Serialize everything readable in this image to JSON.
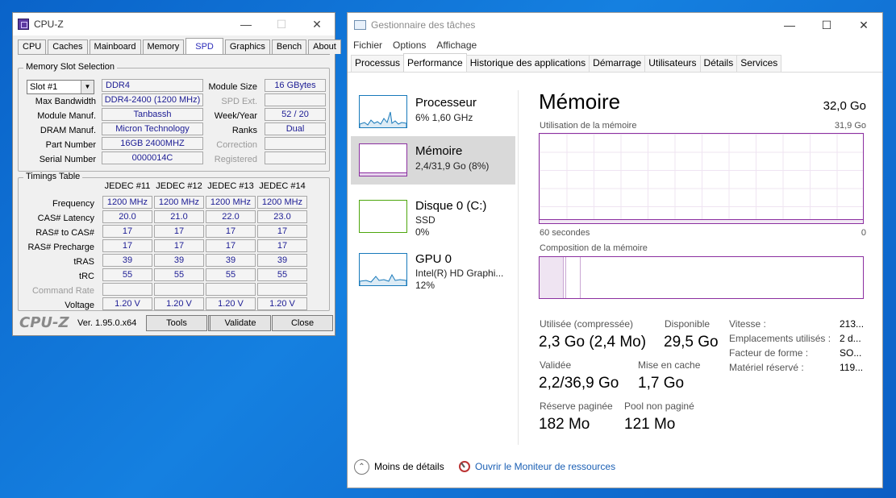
{
  "cpuz": {
    "title": "CPU-Z",
    "tabs": [
      "CPU",
      "Caches",
      "Mainboard",
      "Memory",
      "SPD",
      "Graphics",
      "Bench",
      "About"
    ],
    "active_tab": "SPD",
    "slot_group_title": "Memory Slot Selection",
    "slot_value": "Slot #1",
    "mem_type": "DDR4",
    "module_size_label": "Module Size",
    "module_size": "16 GBytes",
    "max_bw_label": "Max Bandwidth",
    "max_bw": "DDR4-2400 (1200 MHz)",
    "spd_ext_label": "SPD Ext.",
    "module_manuf_label": "Module Manuf.",
    "module_manuf": "Tanbassh",
    "weekyear_label": "Week/Year",
    "weekyear": "52 / 20",
    "dram_manuf_label": "DRAM Manuf.",
    "dram_manuf": "Micron Technology",
    "ranks_label": "Ranks",
    "ranks": "Dual",
    "part_label": "Part Number",
    "part": "16GB 2400MHZ",
    "correction_label": "Correction",
    "serial_label": "Serial Number",
    "serial": "0000014C",
    "registered_label": "Registered",
    "timings_title": "Timings Table",
    "timing_columns": [
      "JEDEC #11",
      "JEDEC #12",
      "JEDEC #13",
      "JEDEC #14"
    ],
    "timing_rows": [
      {
        "label": "Frequency",
        "values": [
          "1200 MHz",
          "1200 MHz",
          "1200 MHz",
          "1200 MHz"
        ]
      },
      {
        "label": "CAS# Latency",
        "values": [
          "20.0",
          "21.0",
          "22.0",
          "23.0"
        ]
      },
      {
        "label": "RAS# to CAS#",
        "values": [
          "17",
          "17",
          "17",
          "17"
        ]
      },
      {
        "label": "RAS# Precharge",
        "values": [
          "17",
          "17",
          "17",
          "17"
        ]
      },
      {
        "label": "tRAS",
        "values": [
          "39",
          "39",
          "39",
          "39"
        ]
      },
      {
        "label": "tRC",
        "values": [
          "55",
          "55",
          "55",
          "55"
        ]
      },
      {
        "label": "Command Rate",
        "values": [
          "",
          "",
          "",
          ""
        ]
      },
      {
        "label": "Voltage",
        "values": [
          "1.20 V",
          "1.20 V",
          "1.20 V",
          "1.20 V"
        ]
      }
    ],
    "brand": "CPU-Z",
    "version": "Ver. 1.95.0.x64",
    "tools": "Tools",
    "validate": "Validate",
    "close": "Close"
  },
  "tm": {
    "title": "Gestionnaire des tâches",
    "menu": [
      "Fichier",
      "Options",
      "Affichage"
    ],
    "tabs": [
      "Processus",
      "Performance",
      "Historique des applications",
      "Démarrage",
      "Utilisateurs",
      "Détails",
      "Services"
    ],
    "active_tab": "Performance",
    "items": [
      {
        "name": "Processeur",
        "line1": "6%  1,60 GHz",
        "line2": "",
        "color": "#1779ba"
      },
      {
        "name": "Mémoire",
        "line1": "2,4/31,9 Go (8%)",
        "line2": "",
        "color": "#8b2fa0"
      },
      {
        "name": "Disque 0 (C:)",
        "line1": "SSD",
        "line2": "0%",
        "color": "#4da60c"
      },
      {
        "name": "GPU 0",
        "line1": "Intel(R) HD Graphi...",
        "line2": "12%",
        "color": "#1779ba"
      }
    ],
    "heading": "Mémoire",
    "total": "32,0 Go",
    "usage_label": "Utilisation de la mémoire",
    "usage_max": "31,9 Go",
    "axis_left": "60 secondes",
    "axis_right": "0",
    "usage_level": 0.08,
    "composition_label": "Composition de la mémoire",
    "stats": {
      "used_label": "Utilisée (compressée)",
      "used": "2,3 Go (2,4 Mo)",
      "avail_label": "Disponible",
      "avail": "29,5 Go",
      "committed_label": "Validée",
      "committed": "2,2/36,9 Go",
      "cached_label": "Mise en cache",
      "cached": "1,7 Go",
      "paged_label": "Réserve paginée",
      "paged": "182 Mo",
      "nonpaged_label": "Pool non paginé",
      "nonpaged": "121 Mo"
    },
    "props": [
      {
        "label": "Vitesse :",
        "value": "213..."
      },
      {
        "label": "Emplacements utilisés :",
        "value": "2 d..."
      },
      {
        "label": "Facteur de forme :",
        "value": "SO..."
      },
      {
        "label": "Matériel réservé :",
        "value": "119..."
      }
    ],
    "less_details": "Moins de détails",
    "resource_monitor": "Ouvrir le Moniteur de ressources"
  }
}
